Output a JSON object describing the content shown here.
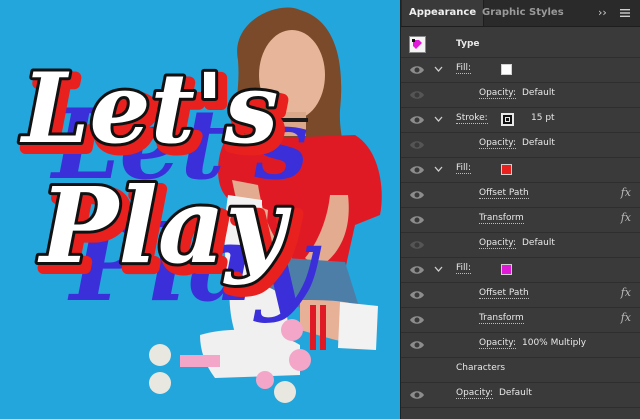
{
  "panel": {
    "tabs": [
      {
        "label": "Appearance",
        "active": true
      },
      {
        "label": "Graphic Styles",
        "active": false
      }
    ],
    "collapse_glyph": "››",
    "menu_icon": "hamburger-menu-icon",
    "header_label": "Type",
    "rows": {
      "fill1": {
        "label": "Fill:",
        "swatch": "#ffffff"
      },
      "opacity1": {
        "label": "Opacity:",
        "value": "Default"
      },
      "stroke": {
        "label": "Stroke:",
        "weight": "15 pt",
        "swatch": "#111111"
      },
      "opacity2": {
        "label": "Opacity:",
        "value": "Default"
      },
      "fill2": {
        "label": "Fill:",
        "swatch": "#e8201e"
      },
      "offset1": {
        "label": "Offset Path",
        "fx": "fx"
      },
      "transform1": {
        "label": "Transform",
        "fx": "fx"
      },
      "opacity3": {
        "label": "Opacity:",
        "value": "Default"
      },
      "fill3": {
        "label": "Fill:",
        "swatch": "#e01bd8"
      },
      "offset2": {
        "label": "Offset Path",
        "fx": "fx"
      },
      "transform2": {
        "label": "Transform",
        "fx": "fx"
      },
      "opacity4": {
        "label": "Opacity:",
        "value": "100% Multiply"
      },
      "characters": {
        "label": "Characters"
      },
      "opacity5": {
        "label": "Opacity:",
        "value": "Default"
      }
    }
  },
  "artwork": {
    "line1": "Let's",
    "line2": "Play",
    "background": "#23a6db",
    "shadow_color": "#3b2fd9",
    "outline_color": "#e8201e",
    "fill_color": "#ffffff",
    "stroke_color": "#111111"
  }
}
